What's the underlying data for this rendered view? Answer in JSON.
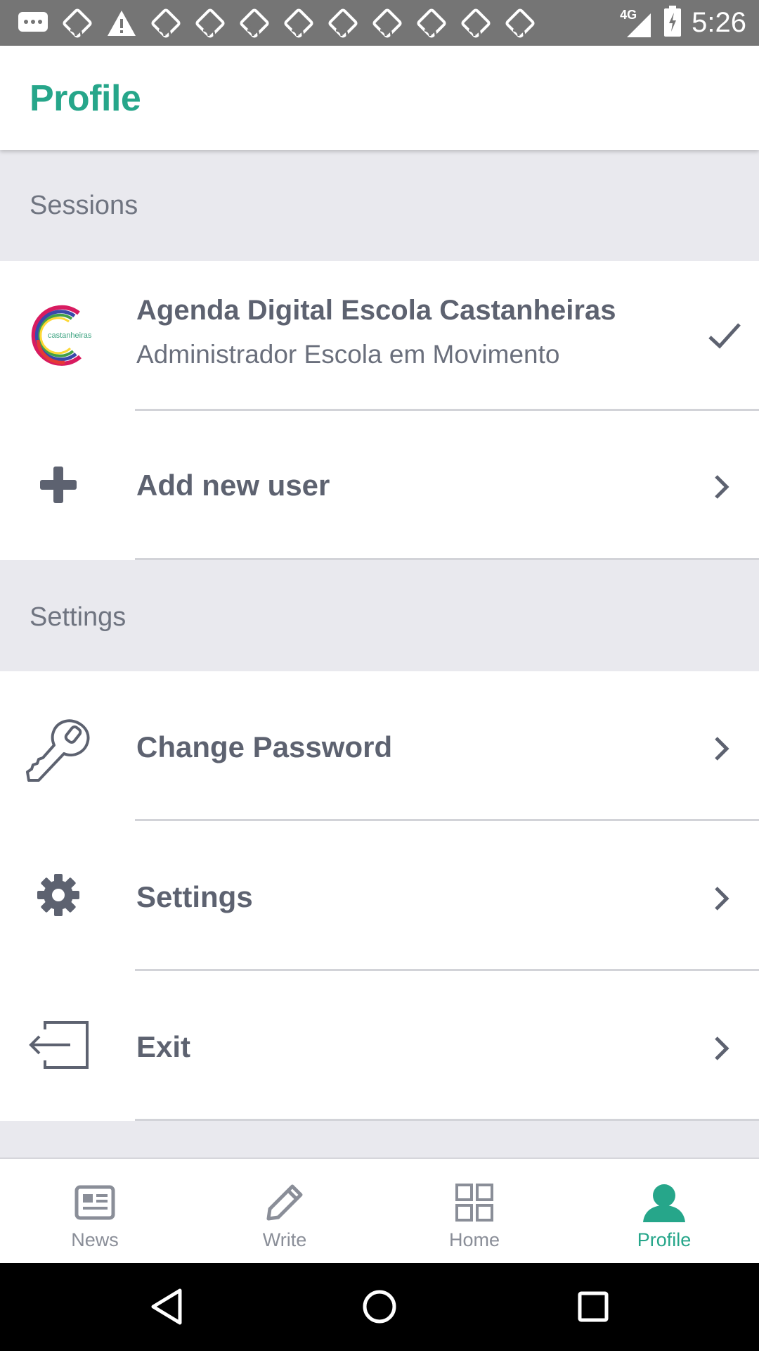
{
  "status_bar": {
    "time": "5:26",
    "network": "4G",
    "notification_icons": [
      "message-icon",
      "cast-icon",
      "warning-icon",
      "cast-icon",
      "cast-icon",
      "cast-icon",
      "cast-icon",
      "cast-icon",
      "cast-icon",
      "cast-icon",
      "cast-icon",
      "cast-icon",
      "cast-icon"
    ]
  },
  "appbar": {
    "title": "Profile"
  },
  "sections": {
    "sessions": "Sessions",
    "settings": "Settings"
  },
  "session": {
    "logo_text": "castanheiras",
    "title": "Agenda Digital Escola Castanheiras",
    "subtitle": "Administrador Escola em Movimento"
  },
  "actions": {
    "add_user": "Add new user",
    "change_password": "Change Password",
    "settings": "Settings",
    "exit": "Exit"
  },
  "bottom_nav": {
    "news": "News",
    "write": "Write",
    "home": "Home",
    "profile": "Profile",
    "active": "profile"
  },
  "colors": {
    "accent": "#26a68a",
    "text": "#5d6270",
    "section_bg": "#e9e9ee"
  }
}
